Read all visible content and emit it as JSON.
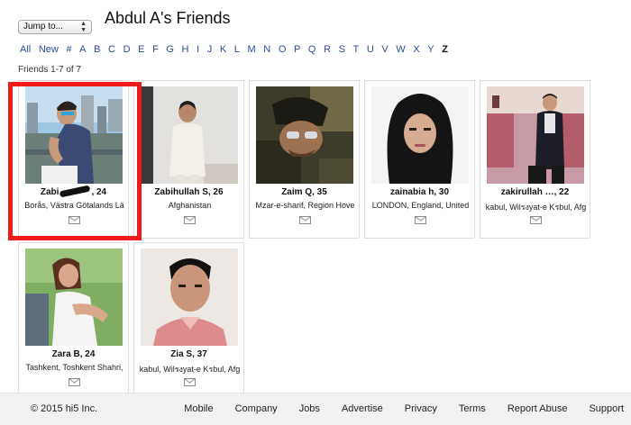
{
  "header": {
    "jump_label": "Jump to...",
    "title": "Abdul A's Friends"
  },
  "alphabet": [
    "All",
    "New",
    "#",
    "A",
    "B",
    "C",
    "D",
    "E",
    "F",
    "G",
    "H",
    "I",
    "J",
    "K",
    "L",
    "M",
    "N",
    "O",
    "P",
    "Q",
    "R",
    "S",
    "T",
    "U",
    "V",
    "W",
    "X",
    "Y",
    "Z"
  ],
  "alphabet_selected": "Z",
  "friends_count": "Friends 1-7 of 7",
  "friends": [
    {
      "name": "Zabi",
      "name_suffix": ", 24",
      "location": "Borås, Västra Götalands Lä",
      "highlighted": true
    },
    {
      "name": "Zabihullah S, 26",
      "location": "Afghanistan"
    },
    {
      "name": "Zaim Q, 35",
      "location": "Mzar-e-sharif, Region Hove"
    },
    {
      "name": "zainabia h, 30",
      "location": "LONDON, England, United"
    },
    {
      "name": "zakirullah …, 22",
      "location": "kabul, Wilรงyat-e Kรbul, Afg"
    },
    {
      "name": "Zara B, 24",
      "location": "Tashkent, Toshkent Shahri,"
    },
    {
      "name": "Zia S, 37",
      "location": "kabul, Wilรงyat-e Kรbul, Afg"
    }
  ],
  "footer": {
    "copyright": "© 2015 hi5 Inc.",
    "links": [
      "Mobile",
      "Company",
      "Jobs",
      "Advertise",
      "Privacy",
      "Terms",
      "Report Abuse",
      "Support"
    ]
  },
  "colors": {
    "link": "#2b4b9b",
    "highlight": "#ee1b1b",
    "footer_bg": "#f1f1f1"
  },
  "icons": {
    "card_action": "mail-icon",
    "jump_dropdown": "chevron-updown-icon"
  }
}
